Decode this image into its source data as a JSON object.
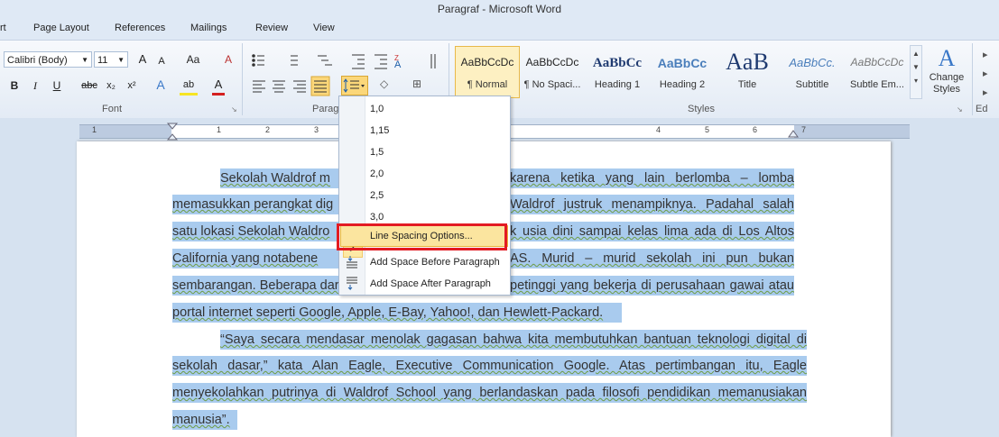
{
  "window": {
    "title": "Paragraf - Microsoft Word"
  },
  "tabs": [
    "rt",
    "Page Layout",
    "References",
    "Mailings",
    "Review",
    "View"
  ],
  "ribbon": {
    "font": {
      "group_label": "Font",
      "font_name": "Calibri (Body)",
      "font_size": "11",
      "grow_label": "A",
      "shrink_label": "A",
      "case_label": "Aa",
      "clear_label": "A",
      "bold": "B",
      "italic": "I",
      "underline": "U",
      "strike": "abc",
      "subscript": "x₂",
      "superscript": "x²",
      "effects": "A",
      "highlight": "ab",
      "font_color": "A"
    },
    "paragraph": {
      "group_label": "Paragr"
    },
    "styles": {
      "group_label": "Styles",
      "items": [
        {
          "sample": "AaBbCcDc",
          "name": "¶ Normal"
        },
        {
          "sample": "AaBbCcDc",
          "name": "¶ No Spaci..."
        },
        {
          "sample": "AaBbCc",
          "name": "Heading 1"
        },
        {
          "sample": "AaBbCc",
          "name": "Heading 2"
        },
        {
          "sample": "AaB",
          "name": "Title"
        },
        {
          "sample": "AaBbCc.",
          "name": "Subtitle"
        },
        {
          "sample": "AaBbCcDc",
          "name": "Subtle Em..."
        }
      ],
      "change_styles": "Change Styles",
      "change_styles_line1": "Change",
      "change_styles_line2": "Styles"
    },
    "editing": {
      "group_label": "Ed"
    }
  },
  "ruler": {
    "numbers": [
      "1",
      "1",
      "2",
      "3",
      "4",
      "5",
      "6",
      "7"
    ]
  },
  "line_spacing_menu": {
    "options": [
      "1,0",
      "1,15",
      "1,5",
      "2,0",
      "2,5",
      "3,0"
    ],
    "selected": "1,5",
    "check_mark": "✓",
    "line_spacing_options": "Line Spacing Options...",
    "add_before": "Add Space Before Paragraph",
    "add_after": "Add Space After Paragraph"
  },
  "document": {
    "lines": [
      "Sekolah Waldrof m",
      "karena ketika yang lain berlomba – lomba",
      "memasukkan perangkat dig",
      "Waldrof justruk menampiknya. Padahal salah",
      "satu lokasi Sekolah Waldro",
      "k usia dini sampai kelas lima ada di Los Altos",
      "California yang notabene",
      "AS. Murid – murid sekolah ini pun bukan",
      "sembarangan. Beberapa dari",
      "petinggi yang bekerja di perusahaan gawai atau",
      "portal internet seperti Google, Apple, E-Bay, Yahoo!, dan Hewlett-Packard.",
      "“Saya secara mendasar menolak gagasan bahwa kita membutuhkan bantuan teknologi digital di",
      "sekolah dasar,” kata Alan Eagle, Executive Communication Google. Atas pertimbangan itu, Eagle",
      "menyekolahkan putrinya di Waldrof School yang berlandaskan pada filosofi pendidikan memanusiakan",
      "manusia”."
    ]
  }
}
